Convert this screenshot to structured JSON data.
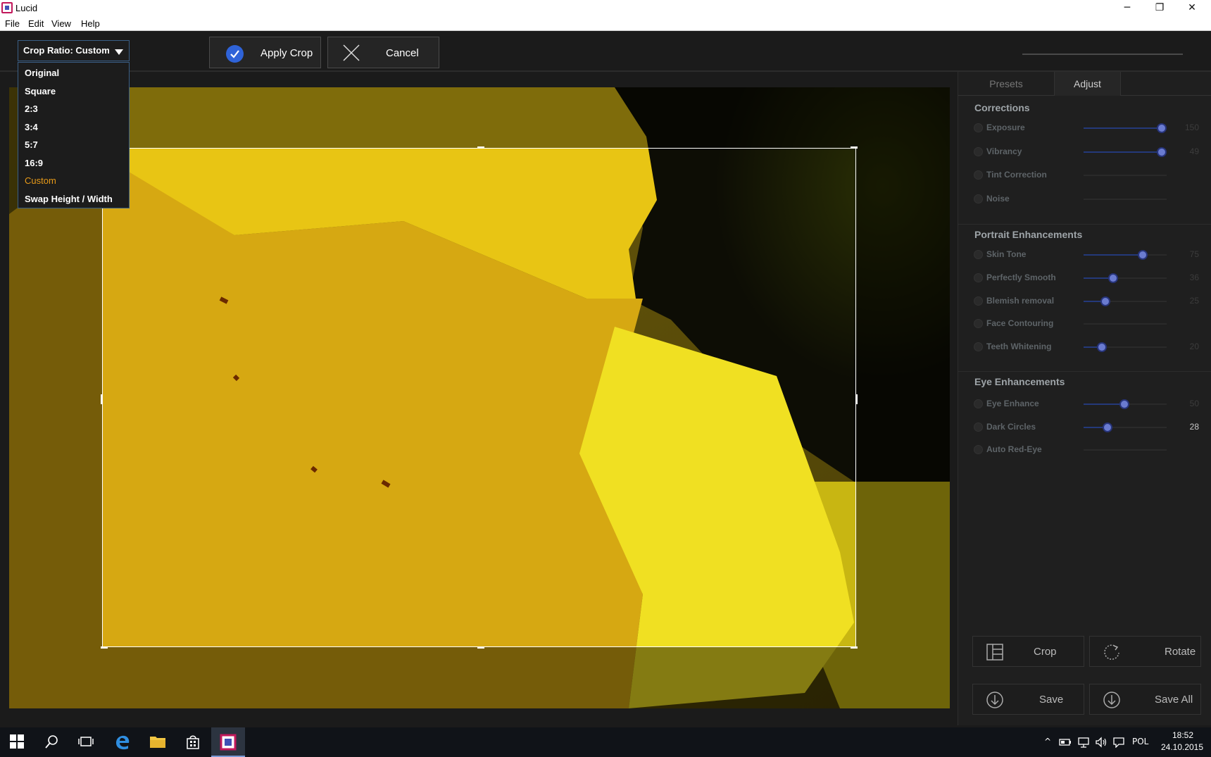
{
  "window": {
    "title": "Lucid",
    "minimize_glyph": "─",
    "restore_glyph": "❐",
    "close_glyph": "✕"
  },
  "menubar": {
    "items": [
      "File",
      "Edit",
      "View",
      "Help"
    ]
  },
  "toolbar": {
    "crop_ratio_label": "Crop Ratio: Custom",
    "apply_label": "Apply Crop",
    "cancel_label": "Cancel"
  },
  "crop_dropdown": {
    "options": [
      "Original",
      "Square",
      "2:3",
      "3:4",
      "5:7",
      "16:9",
      "Custom",
      "Swap Height / Width"
    ],
    "selected": "Custom"
  },
  "right_panel": {
    "tabs": {
      "presets": "Presets",
      "adjust": "Adjust"
    },
    "corrections": {
      "title": "Corrections",
      "items": [
        {
          "label": "Exposure",
          "value": "150",
          "level": 0.94,
          "has_slider": true
        },
        {
          "label": "Vibrancy",
          "value": "49",
          "level": 0.94,
          "has_slider": true
        },
        {
          "label": "Tint Correction",
          "value": "",
          "level": 0,
          "has_slider": false
        },
        {
          "label": "Noise",
          "value": "",
          "level": 0,
          "has_slider": false
        }
      ]
    },
    "portrait": {
      "title": "Portrait Enhancements",
      "items": [
        {
          "label": "Skin Tone",
          "value": "75",
          "level": 0.71,
          "has_slider": true
        },
        {
          "label": "Perfectly Smooth",
          "value": "36",
          "level": 0.36,
          "has_slider": true
        },
        {
          "label": "Blemish removal",
          "value": "25",
          "level": 0.26,
          "has_slider": true
        },
        {
          "label": "Face Contouring",
          "value": "",
          "level": 0,
          "has_slider": false
        },
        {
          "label": "Teeth Whitening",
          "value": "20",
          "level": 0.22,
          "has_slider": true
        }
      ]
    },
    "eye": {
      "title": "Eye Enhancements",
      "items": [
        {
          "label": "Eye Enhance",
          "value": "50",
          "level": 0.49,
          "has_slider": true
        },
        {
          "label": "Dark Circles",
          "value": "28",
          "level": 0.29,
          "has_slider": true,
          "active": true
        },
        {
          "label": "Auto Red-Eye",
          "value": "",
          "level": 0,
          "has_slider": false
        }
      ]
    },
    "buttons": {
      "crop": "Crop",
      "rotate": "Rotate",
      "save": "Save",
      "save_all": "Save All"
    }
  },
  "taskbar": {
    "language": "POL",
    "time": "18:52",
    "date": "24.10.2015"
  },
  "colors": {
    "accent_blue": "#2f63d8",
    "selected_orange": "#e79a18",
    "slider_knob": "#6a7bd0"
  }
}
